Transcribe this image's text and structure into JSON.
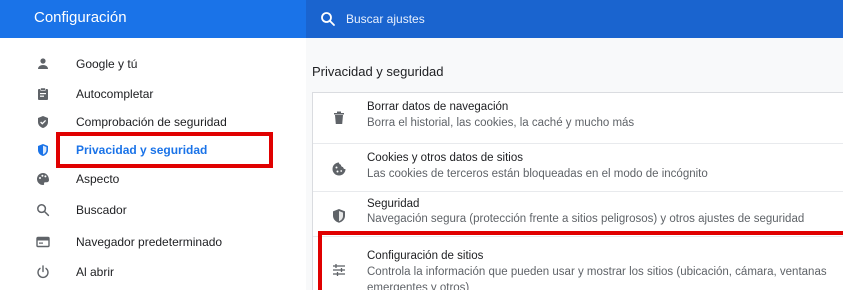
{
  "header": {
    "title": "Configuración",
    "search_placeholder": "Buscar ajustes",
    "search_value": "",
    "search_icon": "search-icon"
  },
  "colors": {
    "accent": "#1a73e8",
    "highlight": "#e00000"
  },
  "sidebar": {
    "items": [
      {
        "label": "Google y tú",
        "icon": "person-icon"
      },
      {
        "label": "Autocompletar",
        "icon": "clipboard-icon"
      },
      {
        "label": "Comprobación de seguridad",
        "icon": "shield-check-icon"
      },
      {
        "label": "Privacidad y seguridad",
        "icon": "shield-icon",
        "active": true
      },
      {
        "label": "Aspecto",
        "icon": "palette-icon"
      },
      {
        "label": "Buscador",
        "icon": "search-icon"
      },
      {
        "label": "Navegador predeterminado",
        "icon": "browser-icon"
      },
      {
        "label": "Al abrir",
        "icon": "power-icon"
      }
    ]
  },
  "main": {
    "section_title": "Privacidad y seguridad",
    "rows": [
      {
        "title": "Borrar datos de navegación",
        "subtitle": "Borra el historial, las cookies, la caché y mucho más",
        "icon": "trash-icon"
      },
      {
        "title": "Cookies y otros datos de sitios",
        "subtitle": "Las cookies de terceros están bloqueadas en el modo de incógnito",
        "icon": "cookie-icon"
      },
      {
        "title": "Seguridad",
        "subtitle": "Navegación segura (protección frente a sitios peligrosos) y otros ajustes de seguridad",
        "icon": "shield-icon"
      },
      {
        "title": "Configuración de sitios",
        "subtitle_line1": "Controla la información que pueden usar y mostrar los sitios (ubicación, cámara, ventanas",
        "subtitle_line2": "emergentes y otros)",
        "icon": "tune-icon"
      }
    ]
  }
}
